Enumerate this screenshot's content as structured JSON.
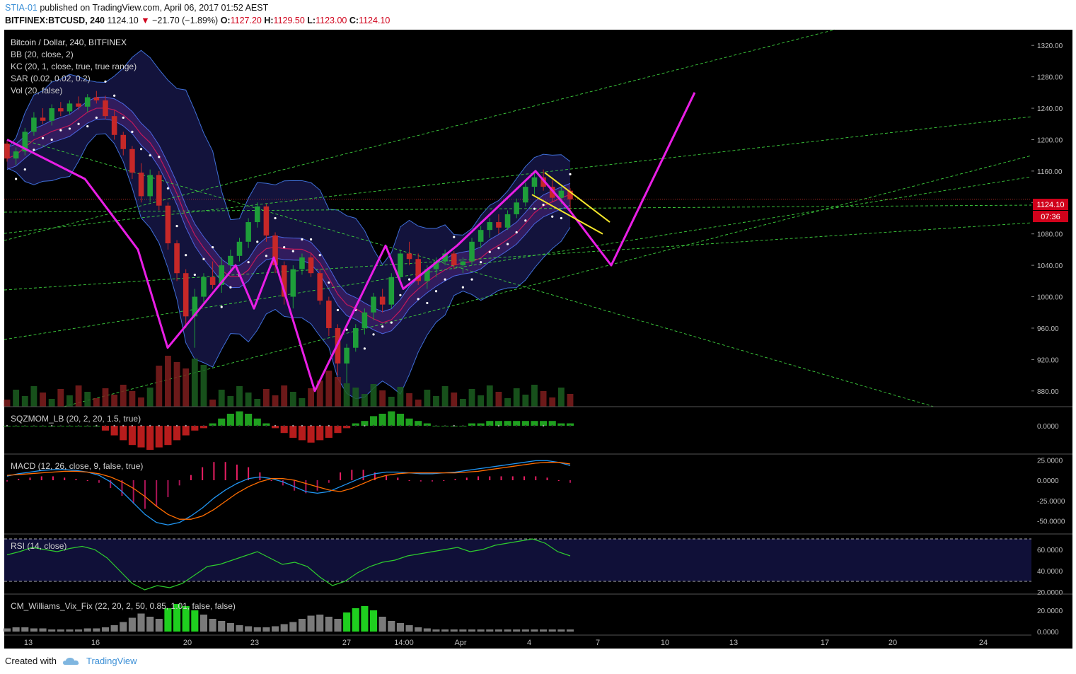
{
  "header": {
    "author": "STIA-01",
    "published_text": "published on TradingView.com, April 06, 2017 01:52 AEST",
    "symbol": "BITFINEX:BTCUSD, 240",
    "last": "1124.10",
    "change_arrow": "▼",
    "change": "−21.70 (−1.89%)",
    "o_label": "O:",
    "o": "1127.20",
    "h_label": "H:",
    "h": "1129.50",
    "l_label": "L:",
    "l": "1123.00",
    "c_label": "C:",
    "c": "1124.10"
  },
  "legend": {
    "title": "Bitcoin / Dollar, 240, BITFINEX",
    "bb": "BB (20, close, 2)",
    "kc": "KC (20, 1, close, true, true range)",
    "sar": "SAR (0.02, 0.02, 0.2)",
    "vol": "Vol (20, false)"
  },
  "price_badge": "1124.10",
  "timer_badge": "07:36",
  "panes": {
    "sqz": "SQZMOM_LB (20, 2, 20, 1.5, true)",
    "macd": "MACD (12, 26, close, 9, false, true)",
    "rsi": "RSI (14, close)",
    "wvf": "CM_Williams_Vix_Fix (22, 20, 2, 50, 0.85, 1.01, false, false)"
  },
  "footer": {
    "created_with": "Created with",
    "brand": "TradingView"
  },
  "colors": {
    "background": "#000000",
    "bull": "#1e9e3a",
    "bear": "#c62828",
    "pink": "#e91ee5",
    "yellow": "#f5e72b",
    "trend": "#3ed13e",
    "band": "#2a2a86"
  },
  "chart_data": [
    {
      "type": "candlestick",
      "title": "Bitcoin / Dollar, 240, BITFINEX",
      "ylim": [
        860,
        1340
      ],
      "y_ticks": [
        "1320.00",
        "1280.00",
        "1240.00",
        "1200.00",
        "1160.00",
        "1120.00",
        "1080.00",
        "1040.00",
        "1000.00",
        "960.00",
        "920.00",
        "880.00"
      ],
      "x_ticks": [
        "13",
        "16",
        "20",
        "23",
        "27",
        "14:00",
        "Apr",
        "4",
        "7",
        "10",
        "13",
        "17",
        "20",
        "24"
      ],
      "last_price": 1124.1,
      "pink_pattern": [
        [
          0,
          1200
        ],
        [
          1,
          1150
        ],
        [
          2,
          1060
        ],
        [
          3,
          935
        ],
        [
          4,
          1040
        ],
        [
          5,
          985
        ],
        [
          6,
          1050
        ],
        [
          7,
          880
        ],
        [
          8,
          1065
        ],
        [
          9,
          1010
        ],
        [
          10,
          1065
        ],
        [
          11,
          1160
        ],
        [
          12,
          1110
        ],
        [
          13,
          1040
        ],
        [
          14,
          1260
        ]
      ],
      "candles": [
        [
          1195,
          1198,
          1172,
          1176
        ],
        [
          1176,
          1190,
          1168,
          1185
        ],
        [
          1185,
          1215,
          1180,
          1210
        ],
        [
          1210,
          1235,
          1205,
          1228
        ],
        [
          1228,
          1240,
          1220,
          1224
        ],
        [
          1224,
          1245,
          1218,
          1240
        ],
        [
          1240,
          1248,
          1230,
          1236
        ],
        [
          1236,
          1250,
          1232,
          1246
        ],
        [
          1246,
          1255,
          1238,
          1242
        ],
        [
          1242,
          1258,
          1235,
          1254
        ],
        [
          1254,
          1262,
          1246,
          1250
        ],
        [
          1250,
          1256,
          1226,
          1230
        ],
        [
          1230,
          1238,
          1200,
          1206
        ],
        [
          1206,
          1210,
          1180,
          1188
        ],
        [
          1188,
          1192,
          1150,
          1158
        ],
        [
          1158,
          1170,
          1120,
          1128
        ],
        [
          1128,
          1162,
          1120,
          1155
        ],
        [
          1155,
          1160,
          1110,
          1116
        ],
        [
          1116,
          1120,
          1060,
          1068
        ],
        [
          1068,
          1072,
          1020,
          1030
        ],
        [
          1030,
          1035,
          960,
          975
        ],
        [
          975,
          1010,
          935,
          1000
        ],
        [
          1000,
          1030,
          990,
          1025
        ],
        [
          1025,
          1045,
          1010,
          1015
        ],
        [
          1015,
          1050,
          1005,
          1040
        ],
        [
          1040,
          1060,
          1030,
          1052
        ],
        [
          1052,
          1075,
          1045,
          1070
        ],
        [
          1070,
          1100,
          1062,
          1095
        ],
        [
          1095,
          1120,
          1088,
          1115
        ],
        [
          1115,
          1118,
          1070,
          1078
        ],
        [
          1078,
          1082,
          1030,
          1040
        ],
        [
          1040,
          1045,
          990,
          1000
        ],
        [
          1000,
          1040,
          985,
          1035
        ],
        [
          1035,
          1055,
          1028,
          1050
        ],
        [
          1050,
          1055,
          1025,
          1030
        ],
        [
          1030,
          1035,
          990,
          995
        ],
        [
          995,
          1000,
          950,
          960
        ],
        [
          960,
          965,
          900,
          915
        ],
        [
          915,
          940,
          890,
          935
        ],
        [
          935,
          965,
          930,
          960
        ],
        [
          960,
          985,
          952,
          980
        ],
        [
          980,
          1005,
          970,
          1000
        ],
        [
          1000,
          1010,
          980,
          990
        ],
        [
          990,
          1030,
          985,
          1025
        ],
        [
          1025,
          1060,
          1020,
          1055
        ],
        [
          1055,
          1070,
          1040,
          1048
        ],
        [
          1048,
          1055,
          1015,
          1020
        ],
        [
          1020,
          1040,
          1010,
          1035
        ],
        [
          1035,
          1050,
          1025,
          1045
        ],
        [
          1045,
          1060,
          1040,
          1055
        ],
        [
          1055,
          1058,
          1035,
          1040
        ],
        [
          1040,
          1050,
          1030,
          1045
        ],
        [
          1045,
          1075,
          1040,
          1070
        ],
        [
          1070,
          1090,
          1062,
          1085
        ],
        [
          1085,
          1100,
          1075,
          1095
        ],
        [
          1095,
          1105,
          1080,
          1088
        ],
        [
          1088,
          1110,
          1085,
          1105
        ],
        [
          1105,
          1125,
          1100,
          1120
        ],
        [
          1120,
          1145,
          1115,
          1140
        ],
        [
          1140,
          1158,
          1130,
          1152
        ],
        [
          1152,
          1162,
          1135,
          1140
        ],
        [
          1140,
          1148,
          1120,
          1126
        ],
        [
          1126,
          1140,
          1118,
          1135
        ],
        [
          1135,
          1138,
          1110,
          1124
        ]
      ]
    },
    {
      "type": "bar",
      "title": "SQZMOM_LB (20, 2, 20, 1.5, true)",
      "y_ticks": [
        "0.0000"
      ],
      "values": [
        0,
        0,
        0,
        0,
        0,
        0,
        0,
        0,
        0,
        0,
        0,
        -2,
        -4,
        -6,
        -8,
        -9,
        -10,
        -9,
        -8,
        -6,
        -4,
        -2,
        -1,
        1,
        3,
        5,
        6,
        5,
        3,
        1,
        -1,
        -3,
        -5,
        -6,
        -7,
        -6,
        -5,
        -3,
        -1,
        1,
        2,
        4,
        5,
        6,
        5,
        3,
        2,
        1,
        0,
        0,
        0,
        0,
        1,
        1,
        2,
        2,
        2,
        2,
        2,
        2,
        2,
        2,
        1,
        1
      ]
    },
    {
      "type": "line",
      "title": "MACD (12, 26, close, 9, false, true)",
      "y_ticks": [
        "25.0000",
        "0.0000",
        "-25.0000",
        "-50.0000"
      ],
      "series": [
        {
          "values": [
            5,
            8,
            10,
            12,
            13,
            13,
            12,
            10,
            6,
            -2,
            -14,
            -28,
            -42,
            -52,
            -55,
            -52,
            -44,
            -34,
            -22,
            -12,
            -4,
            2,
            4,
            2,
            -2,
            -8,
            -14,
            -16,
            -14,
            -8,
            -2,
            4,
            8,
            10,
            10,
            9,
            8,
            8,
            9,
            10,
            12,
            14,
            16,
            18,
            20,
            22,
            24,
            24,
            22,
            18
          ]
        },
        {
          "values": [
            6,
            7,
            8,
            9,
            10,
            11,
            11,
            10,
            8,
            4,
            -2,
            -10,
            -20,
            -32,
            -42,
            -48,
            -48,
            -44,
            -36,
            -26,
            -16,
            -8,
            -2,
            2,
            2,
            0,
            -4,
            -8,
            -12,
            -14,
            -10,
            -4,
            2,
            6,
            8,
            9,
            9,
            9,
            9,
            9,
            10,
            11,
            13,
            15,
            17,
            19,
            21,
            22,
            22,
            20
          ]
        }
      ]
    },
    {
      "type": "line",
      "title": "RSI (14, close)",
      "y_ticks": [
        "60.0000",
        "40.0000",
        "20.0000"
      ],
      "values": [
        55,
        58,
        62,
        60,
        58,
        61,
        63,
        60,
        52,
        40,
        28,
        22,
        26,
        24,
        28,
        36,
        44,
        46,
        50,
        54,
        58,
        52,
        46,
        48,
        44,
        34,
        26,
        30,
        38,
        44,
        48,
        50,
        54,
        56,
        58,
        60,
        62,
        58,
        60,
        64,
        66,
        68,
        70,
        66,
        58,
        54
      ]
    },
    {
      "type": "bar",
      "title": "CM_Williams_Vix_Fix (22, 20, 2, 50, 0.85, 1.01, false, false)",
      "y_ticks": [
        "20.0000",
        "0.0000"
      ],
      "values": [
        3,
        4,
        4,
        3,
        3,
        2,
        2,
        2,
        2,
        3,
        3,
        4,
        6,
        9,
        13,
        17,
        14,
        12,
        22,
        26,
        24,
        20,
        16,
        12,
        10,
        8,
        6,
        5,
        4,
        4,
        5,
        7,
        9,
        12,
        15,
        16,
        14,
        12,
        18,
        22,
        24,
        20,
        14,
        10,
        8,
        6,
        4,
        3,
        2,
        2,
        2,
        2,
        2,
        2,
        2,
        2,
        2,
        2,
        2,
        2,
        2,
        2,
        2,
        2
      ]
    }
  ]
}
